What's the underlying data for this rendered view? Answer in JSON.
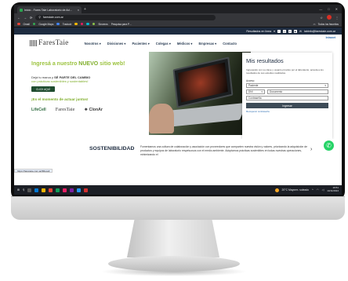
{
  "browser": {
    "tab_title": "Inicio - Fares Taie Laboratorio de Ad…",
    "tab_close": "×",
    "new_tab": "+",
    "address": "farestaie.com.ar",
    "bookmarks": [
      "Gmail",
      "Google Maps",
      "Traducir",
      "Sinceros",
      "Pesquisa para P…"
    ],
    "bookmarks_right": "Todos los favoritos"
  },
  "site": {
    "topstrip_text": "Resultados en línea",
    "topstrip_email": "labinfo@farestaie.com.ar",
    "intranet": "Intranet",
    "logo": "FaresTaie",
    "menu": [
      "Nosotros ▾",
      "Divisiones ▾",
      "Pacientes ▾",
      "Colegas ▾",
      "Médicos ▾",
      "Empresas ▾",
      "Contacto"
    ],
    "hero": {
      "title_pre": "Ingresá a nuestro ",
      "title_bold": "NUEVO",
      "title_post": " sitio web!",
      "sub_line1_pre": "Dejá tu marca y ",
      "sub_line1_bold": "SÉ PARTE DEL CAMBIO",
      "sub_line2": "con prácticas sostenibles y sustentables!",
      "button": "CLICK AQUÍ",
      "cta": "¡Es el momento de actuar juntos!",
      "partners": [
        "LifeCell",
        "FaresTaie",
        "ClonAr"
      ]
    },
    "results": {
      "title": "Mis resultados",
      "desc": "Ingresando con su clave y usuario provisto por el laboratorio, acceda a los resultados de sus estudios realizados.",
      "access_label": "Acceso",
      "access_value": "Paciente",
      "doc_type": "DNI",
      "doc_placeholder": "Documento",
      "password_placeholder": "Contraseña",
      "submit": "Ingresar",
      "forgot": "Recuperar contraseña"
    },
    "sustainability": {
      "heading": "SOSTENIBILIDAD",
      "text": "Fomentamos una cultura de colaboración y asociación con proveedores que comparten nuestra visión y valores, priorizando la adquisición de productos y equipos de laboratorio respetuosos con el medio ambiente. Adoptamos prácticas sostenibles en todas nuestras operaciones, minimizando el",
      "arrow": "›"
    },
    "status_url": "https://farestaie.com.ar/#lifecell",
    "whatsapp": "✆"
  },
  "taskbar": {
    "weather": "20°C  Mayorm. soleado",
    "time": "19:51",
    "date": "14/11/2024"
  },
  "colors": {
    "brand_navy": "#1e2c40",
    "brand_green": "#7fae2a",
    "whatsapp": "#25d366"
  }
}
